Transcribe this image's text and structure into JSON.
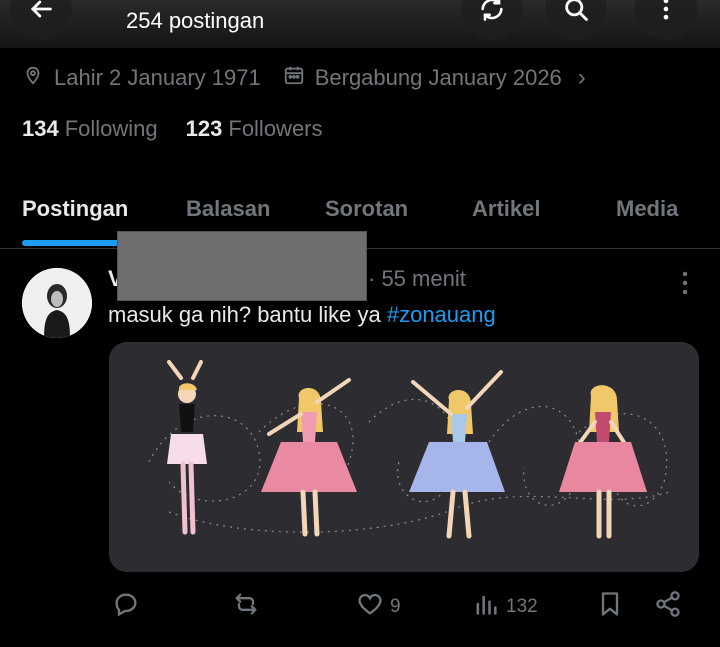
{
  "header": {
    "post_count": "254 postingan"
  },
  "profile": {
    "birth": "Lahir 2 January 1971",
    "joined": "Bergabung January 2026",
    "following_count": "134",
    "following_label": "Following",
    "followers_count": "123",
    "followers_label": "Followers"
  },
  "tabs": [
    {
      "label": "Postingan",
      "active": true
    },
    {
      "label": "Balasan"
    },
    {
      "label": "Sorotan"
    },
    {
      "label": "Artikel"
    },
    {
      "label": "Media"
    }
  ],
  "tweet": {
    "author_partial": "V",
    "time": "· 55 menit",
    "text": "masuk ga nih? bantu like ya ",
    "hashtag": "#zonauang",
    "actions": {
      "reply_count": "",
      "retweet_count": "",
      "like_count": "9",
      "views_count": "132"
    }
  },
  "colors": {
    "accent": "#1d9bf0",
    "muted": "#71767b",
    "text": "#e7e9ea",
    "background": "#000000"
  },
  "icons": {
    "back": "arrow-left-icon",
    "share": "refresh-icon",
    "search": "search-icon",
    "more": "more-vertical-icon",
    "location": "location-pin-icon",
    "calendar": "calendar-icon",
    "reply": "reply-icon",
    "retweet": "retweet-icon",
    "like": "heart-icon",
    "views": "bar-chart-icon",
    "bookmark": "bookmark-icon",
    "share_post": "share-icon"
  }
}
